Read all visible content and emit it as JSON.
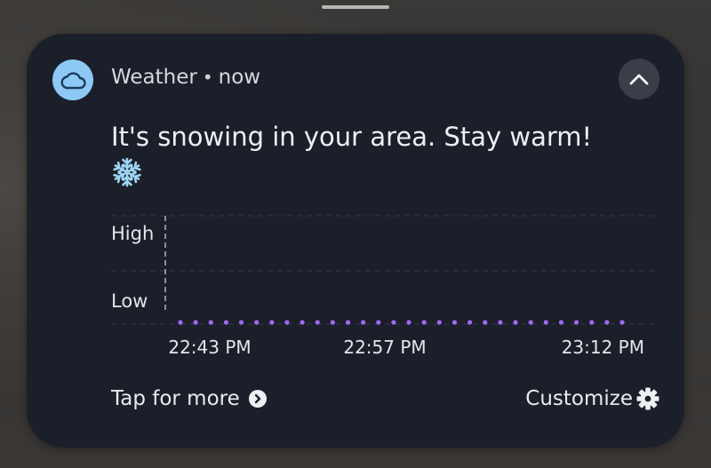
{
  "notification": {
    "app_name": "Weather",
    "separator": "•",
    "time": "now",
    "message": "It's snowing in your area. Stay warm!",
    "message_emoji": "❄️",
    "icons": {
      "app": "cloud-icon",
      "collapse": "chevron-up-icon",
      "tap_more": "chevron-right-circle-icon",
      "customize": "gear-icon"
    },
    "tap_for_more_label": "Tap for more",
    "customize_label": "Customize"
  },
  "colors": {
    "card_bg": "#1b1f2a",
    "app_icon_bg": "#8ec9f5",
    "series_color": "#9b6cf0"
  },
  "chart_data": {
    "type": "scatter",
    "y_categories": [
      "Low",
      "High"
    ],
    "x_tick_labels": [
      "22:43 PM",
      "22:57 PM",
      "23:12 PM"
    ],
    "series": [
      {
        "values": [
          "Low",
          "Low",
          "Low",
          "Low",
          "Low",
          "Low",
          "Low",
          "Low",
          "Low",
          "Low",
          "Low",
          "Low",
          "Low",
          "Low",
          "Low",
          "Low",
          "Low",
          "Low",
          "Low",
          "Low",
          "Low",
          "Low",
          "Low",
          "Low",
          "Low",
          "Low",
          "Low",
          "Low",
          "Low",
          "Low"
        ]
      }
    ],
    "grid": true
  }
}
